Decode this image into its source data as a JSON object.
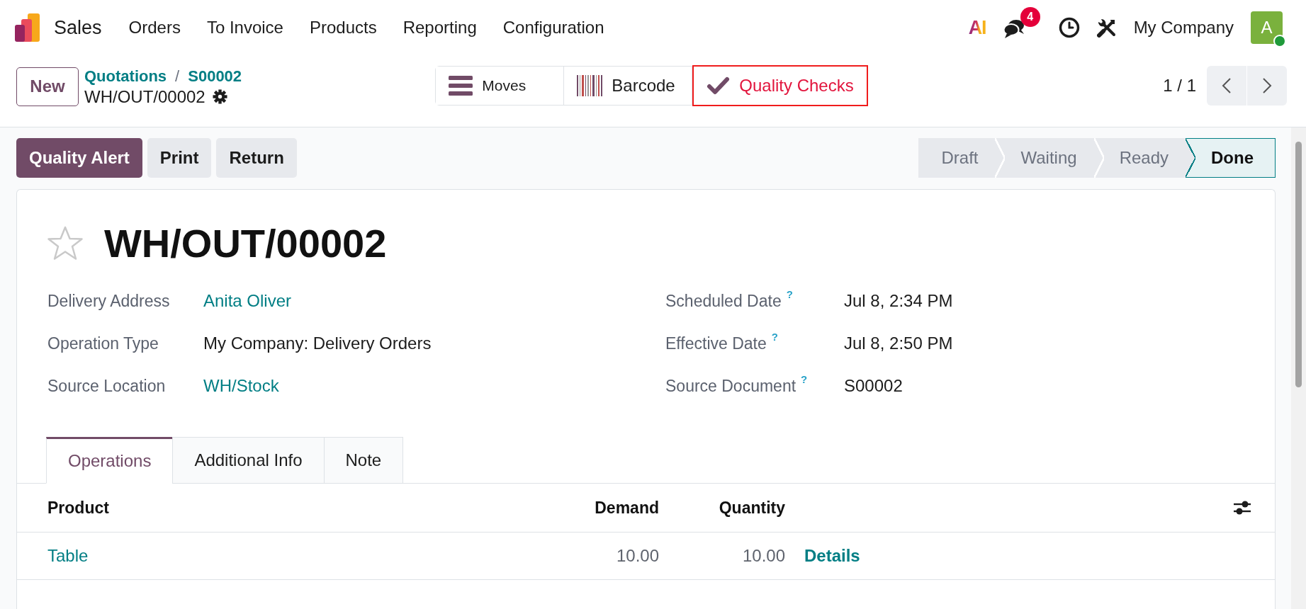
{
  "navbar": {
    "app_name": "Sales",
    "menu": [
      "Orders",
      "To Invoice",
      "Products",
      "Reporting",
      "Configuration"
    ],
    "ai_label": "AI",
    "chat_badge": "4",
    "company": "My Company",
    "user": {
      "initial": "A",
      "online": true
    }
  },
  "control_panel": {
    "new_button": "New",
    "breadcrumbs": [
      "Quotations",
      "S00002"
    ],
    "breadcrumb_separator": "/",
    "record_name": "WH/OUT/00002",
    "smart_buttons": [
      {
        "kind": "moves",
        "label": "Moves",
        "highlighted": false
      },
      {
        "kind": "barcode",
        "label": "Barcode",
        "highlighted": false
      },
      {
        "kind": "quality",
        "label": "Quality Checks",
        "highlighted": true
      }
    ],
    "pager": "1 / 1"
  },
  "action_buttons": [
    {
      "kind": "primary",
      "label": "Quality Alert"
    },
    {
      "kind": "secondary",
      "label": "Print"
    },
    {
      "kind": "secondary",
      "label": "Return"
    }
  ],
  "status_stages": [
    {
      "label": "Draft",
      "selected": false
    },
    {
      "label": "Waiting",
      "selected": false
    },
    {
      "label": "Ready",
      "selected": false
    },
    {
      "label": "Done",
      "selected": true
    }
  ],
  "form": {
    "title": "WH/OUT/00002",
    "starred": false,
    "left_fields": [
      {
        "label": "Delivery Address",
        "kind": "link",
        "value": "Anita Oliver"
      },
      {
        "label": "Operation Type",
        "kind": "text",
        "value": "My Company: Delivery Orders"
      },
      {
        "label": "Source Location",
        "kind": "link",
        "value": "WH/Stock"
      }
    ],
    "right_fields": [
      {
        "label": "Scheduled Date",
        "help": "?",
        "kind": "text",
        "value": "Jul 8, 2:34 PM"
      },
      {
        "label": "Effective Date",
        "help": "?",
        "kind": "text",
        "value": "Jul 8, 2:50 PM"
      },
      {
        "label": "Source Document",
        "help": "?",
        "kind": "text",
        "value": "S00002"
      }
    ]
  },
  "tabs": [
    {
      "label": "Operations",
      "selected": true
    },
    {
      "label": "Additional Info",
      "selected": false
    },
    {
      "label": "Note",
      "selected": false
    }
  ],
  "table": {
    "columns": [
      "Product",
      "Demand",
      "Quantity"
    ],
    "rows": [
      {
        "product": "Table",
        "demand": "10.00",
        "quantity": "10.00",
        "action": "Details"
      }
    ]
  }
}
